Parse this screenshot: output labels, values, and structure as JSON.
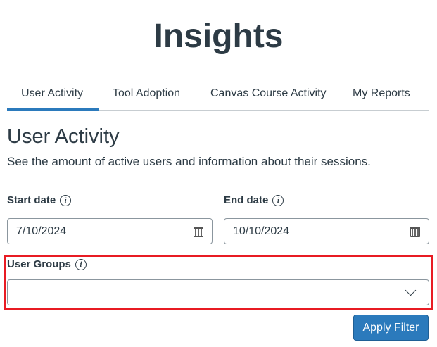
{
  "header": {
    "title": "Insights"
  },
  "tabs": [
    {
      "label": "User Activity",
      "selected": true
    },
    {
      "label": "Tool Adoption"
    },
    {
      "label": "Canvas Course Activity"
    },
    {
      "label": "My Reports"
    }
  ],
  "section": {
    "title": "User Activity",
    "description": "See the amount of active users and information about their sessions."
  },
  "form": {
    "start_date": {
      "label": "Start date",
      "value": "7/10/2024"
    },
    "end_date": {
      "label": "End date",
      "value": "10/10/2024"
    },
    "user_groups": {
      "label": "User Groups",
      "value": ""
    },
    "info_glyph": "i",
    "apply_label": "Apply Filter"
  },
  "colors": {
    "accent": "#2b7abc",
    "highlight": "#e81b23"
  }
}
